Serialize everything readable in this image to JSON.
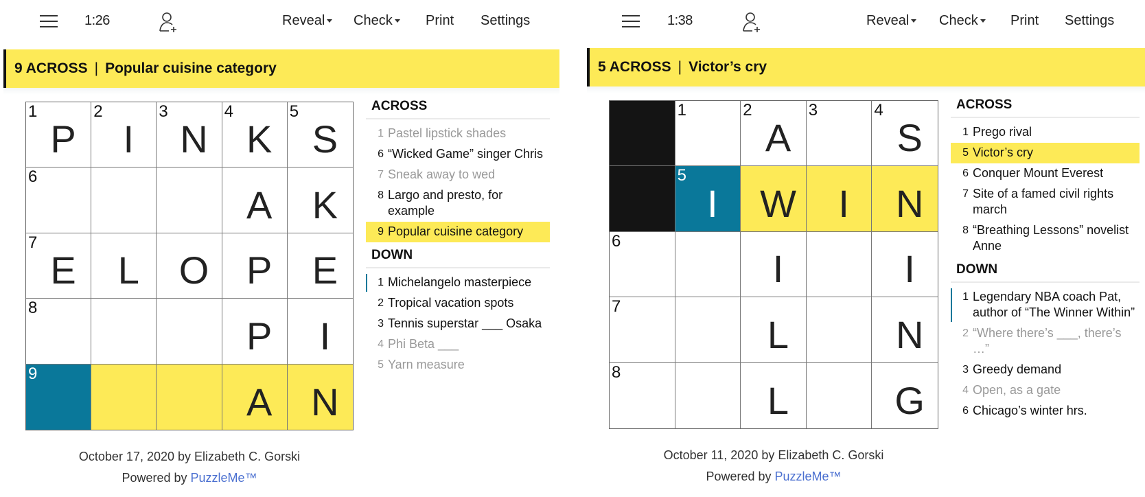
{
  "colors": {
    "highlight": "#fdea57",
    "current_cell": "#0a789a",
    "block": "#141414"
  },
  "panels": [
    {
      "timer": "1:26",
      "nav": {
        "reveal": "Reveal",
        "check": "Check",
        "print": "Print",
        "settings": "Settings"
      },
      "current_clue": {
        "label": "9 ACROSS",
        "separator": "|",
        "text": "Popular cuisine category"
      },
      "grid": {
        "rows": 5,
        "cols": 5,
        "cells": [
          [
            {
              "n": "1",
              "l": "P"
            },
            {
              "n": "2",
              "l": "I"
            },
            {
              "n": "3",
              "l": "N"
            },
            {
              "n": "4",
              "l": "K"
            },
            {
              "n": "5",
              "l": "S"
            }
          ],
          [
            {
              "n": "6",
              "l": ""
            },
            {
              "n": "",
              "l": ""
            },
            {
              "n": "",
              "l": ""
            },
            {
              "n": "",
              "l": "A"
            },
            {
              "n": "",
              "l": "K"
            }
          ],
          [
            {
              "n": "7",
              "l": "E"
            },
            {
              "n": "",
              "l": "L"
            },
            {
              "n": "",
              "l": "O"
            },
            {
              "n": "",
              "l": "P"
            },
            {
              "n": "",
              "l": "E"
            }
          ],
          [
            {
              "n": "8",
              "l": ""
            },
            {
              "n": "",
              "l": ""
            },
            {
              "n": "",
              "l": ""
            },
            {
              "n": "",
              "l": "P"
            },
            {
              "n": "",
              "l": "I"
            }
          ],
          [
            {
              "n": "9",
              "l": "",
              "s": "cur"
            },
            {
              "n": "",
              "l": "",
              "s": "hl"
            },
            {
              "n": "",
              "l": "",
              "s": "hl"
            },
            {
              "n": "",
              "l": "A",
              "s": "hl"
            },
            {
              "n": "",
              "l": "N",
              "s": "hl"
            }
          ]
        ]
      },
      "across_label": "ACROSS",
      "across": [
        {
          "num": "1",
          "text": "Pastel lipstick shades",
          "state": "done"
        },
        {
          "num": "6",
          "text": "“Wicked Game” singer Chris",
          "state": ""
        },
        {
          "num": "7",
          "text": "Sneak away to wed",
          "state": "done"
        },
        {
          "num": "8",
          "text": "Largo and presto, for example",
          "state": ""
        },
        {
          "num": "9",
          "text": "Popular cuisine category",
          "state": "active"
        }
      ],
      "down_label": "DOWN",
      "down": [
        {
          "num": "1",
          "text": "Michelangelo masterpiece",
          "state": "cross"
        },
        {
          "num": "2",
          "text": "Tropical vacation spots",
          "state": ""
        },
        {
          "num": "3",
          "text": "Tennis superstar ___ Osaka",
          "state": ""
        },
        {
          "num": "4",
          "text": "Phi Beta ___",
          "state": "done"
        },
        {
          "num": "5",
          "text": "Yarn measure",
          "state": "done"
        }
      ],
      "footer": {
        "byline": "October 17, 2020 by Elizabeth C. Gorski",
        "powered_prefix": "Powered by ",
        "powered_link": "PuzzleMe™"
      }
    },
    {
      "timer": "1:38",
      "nav": {
        "reveal": "Reveal",
        "check": "Check",
        "print": "Print",
        "settings": "Settings"
      },
      "current_clue": {
        "label": "5 ACROSS",
        "separator": "|",
        "text": "Victor’s cry"
      },
      "grid": {
        "rows": 5,
        "cols": 5,
        "cells": [
          [
            {
              "n": "",
              "l": "",
              "s": "block"
            },
            {
              "n": "1",
              "l": ""
            },
            {
              "n": "2",
              "l": "A"
            },
            {
              "n": "3",
              "l": ""
            },
            {
              "n": "4",
              "l": "S"
            }
          ],
          [
            {
              "n": "",
              "l": "",
              "s": "block"
            },
            {
              "n": "5",
              "l": "I",
              "s": "cur"
            },
            {
              "n": "",
              "l": "W",
              "s": "hl"
            },
            {
              "n": "",
              "l": "I",
              "s": "hl"
            },
            {
              "n": "",
              "l": "N",
              "s": "hl"
            }
          ],
          [
            {
              "n": "6",
              "l": ""
            },
            {
              "n": "",
              "l": ""
            },
            {
              "n": "",
              "l": "I"
            },
            {
              "n": "",
              "l": ""
            },
            {
              "n": "",
              "l": "I"
            }
          ],
          [
            {
              "n": "7",
              "l": ""
            },
            {
              "n": "",
              "l": ""
            },
            {
              "n": "",
              "l": "L"
            },
            {
              "n": "",
              "l": ""
            },
            {
              "n": "",
              "l": "N"
            }
          ],
          [
            {
              "n": "8",
              "l": ""
            },
            {
              "n": "",
              "l": ""
            },
            {
              "n": "",
              "l": "L"
            },
            {
              "n": "",
              "l": ""
            },
            {
              "n": "",
              "l": "G"
            }
          ]
        ]
      },
      "across_label": "ACROSS",
      "across": [
        {
          "num": "1",
          "text": "Prego rival",
          "state": ""
        },
        {
          "num": "5",
          "text": "Victor’s cry",
          "state": "active"
        },
        {
          "num": "6",
          "text": "Conquer Mount Everest",
          "state": ""
        },
        {
          "num": "7",
          "text": "Site of a famed civil rights march",
          "state": ""
        },
        {
          "num": "8",
          "text": "“Breathing Lessons” novelist Anne",
          "state": ""
        }
      ],
      "down_label": "DOWN",
      "down": [
        {
          "num": "1",
          "text": "Legendary NBA coach Pat, author of “The Winner Within”",
          "state": "cross"
        },
        {
          "num": "2",
          "text": "“Where there’s ___, there’s …”",
          "state": "done"
        },
        {
          "num": "3",
          "text": "Greedy demand",
          "state": ""
        },
        {
          "num": "4",
          "text": "Open, as a gate",
          "state": "done"
        },
        {
          "num": "6",
          "text": "Chicago’s winter hrs.",
          "state": ""
        }
      ],
      "footer": {
        "byline": "October 11, 2020 by Elizabeth C. Gorski",
        "powered_prefix": "Powered by ",
        "powered_link": "PuzzleMe™"
      }
    }
  ]
}
